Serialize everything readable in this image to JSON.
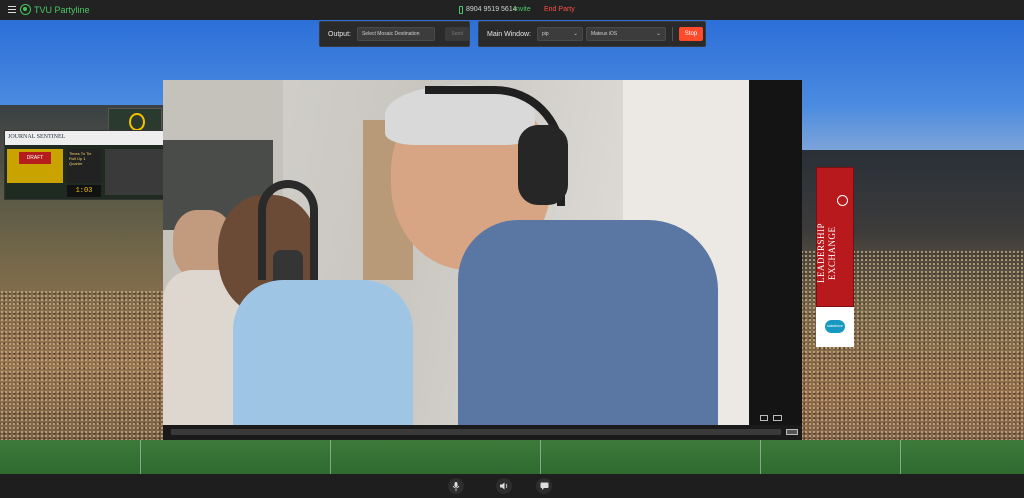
{
  "topbar": {
    "app_title": "TVU Partyline",
    "phone_number": "8904 9519 5614",
    "invite_label": "Invite",
    "end_party_label": "End Party"
  },
  "output_panel": {
    "label": "Output:",
    "destination_placeholder": "Select Mosaic Destination",
    "send_label": "Send"
  },
  "main_window_panel": {
    "label": "Main Window:",
    "layout_value": "pip",
    "source_value": "Mateus iOS",
    "stop_label": "Stop"
  },
  "scoreboard": {
    "sign_text": "JOURNAL SENTINEL",
    "draft_text": "DRAFT",
    "clock": "1:03",
    "side_text": "Times To Tie Roll Up 1 Quarter"
  },
  "ad_banner": {
    "line1": "LEADERSHIP",
    "line2": "EXCHANGE",
    "sponsor": "salesforce"
  },
  "icons": [
    "menu-icon",
    "logo-icon",
    "phone-icon",
    "microphone-icon",
    "speaker-icon",
    "chat-icon",
    "fullscreen-icon",
    "pip-icon"
  ],
  "colors": {
    "accent_green": "#4cc866",
    "danger_red": "#ff4f48",
    "stop_orange": "#ff4b2b"
  }
}
